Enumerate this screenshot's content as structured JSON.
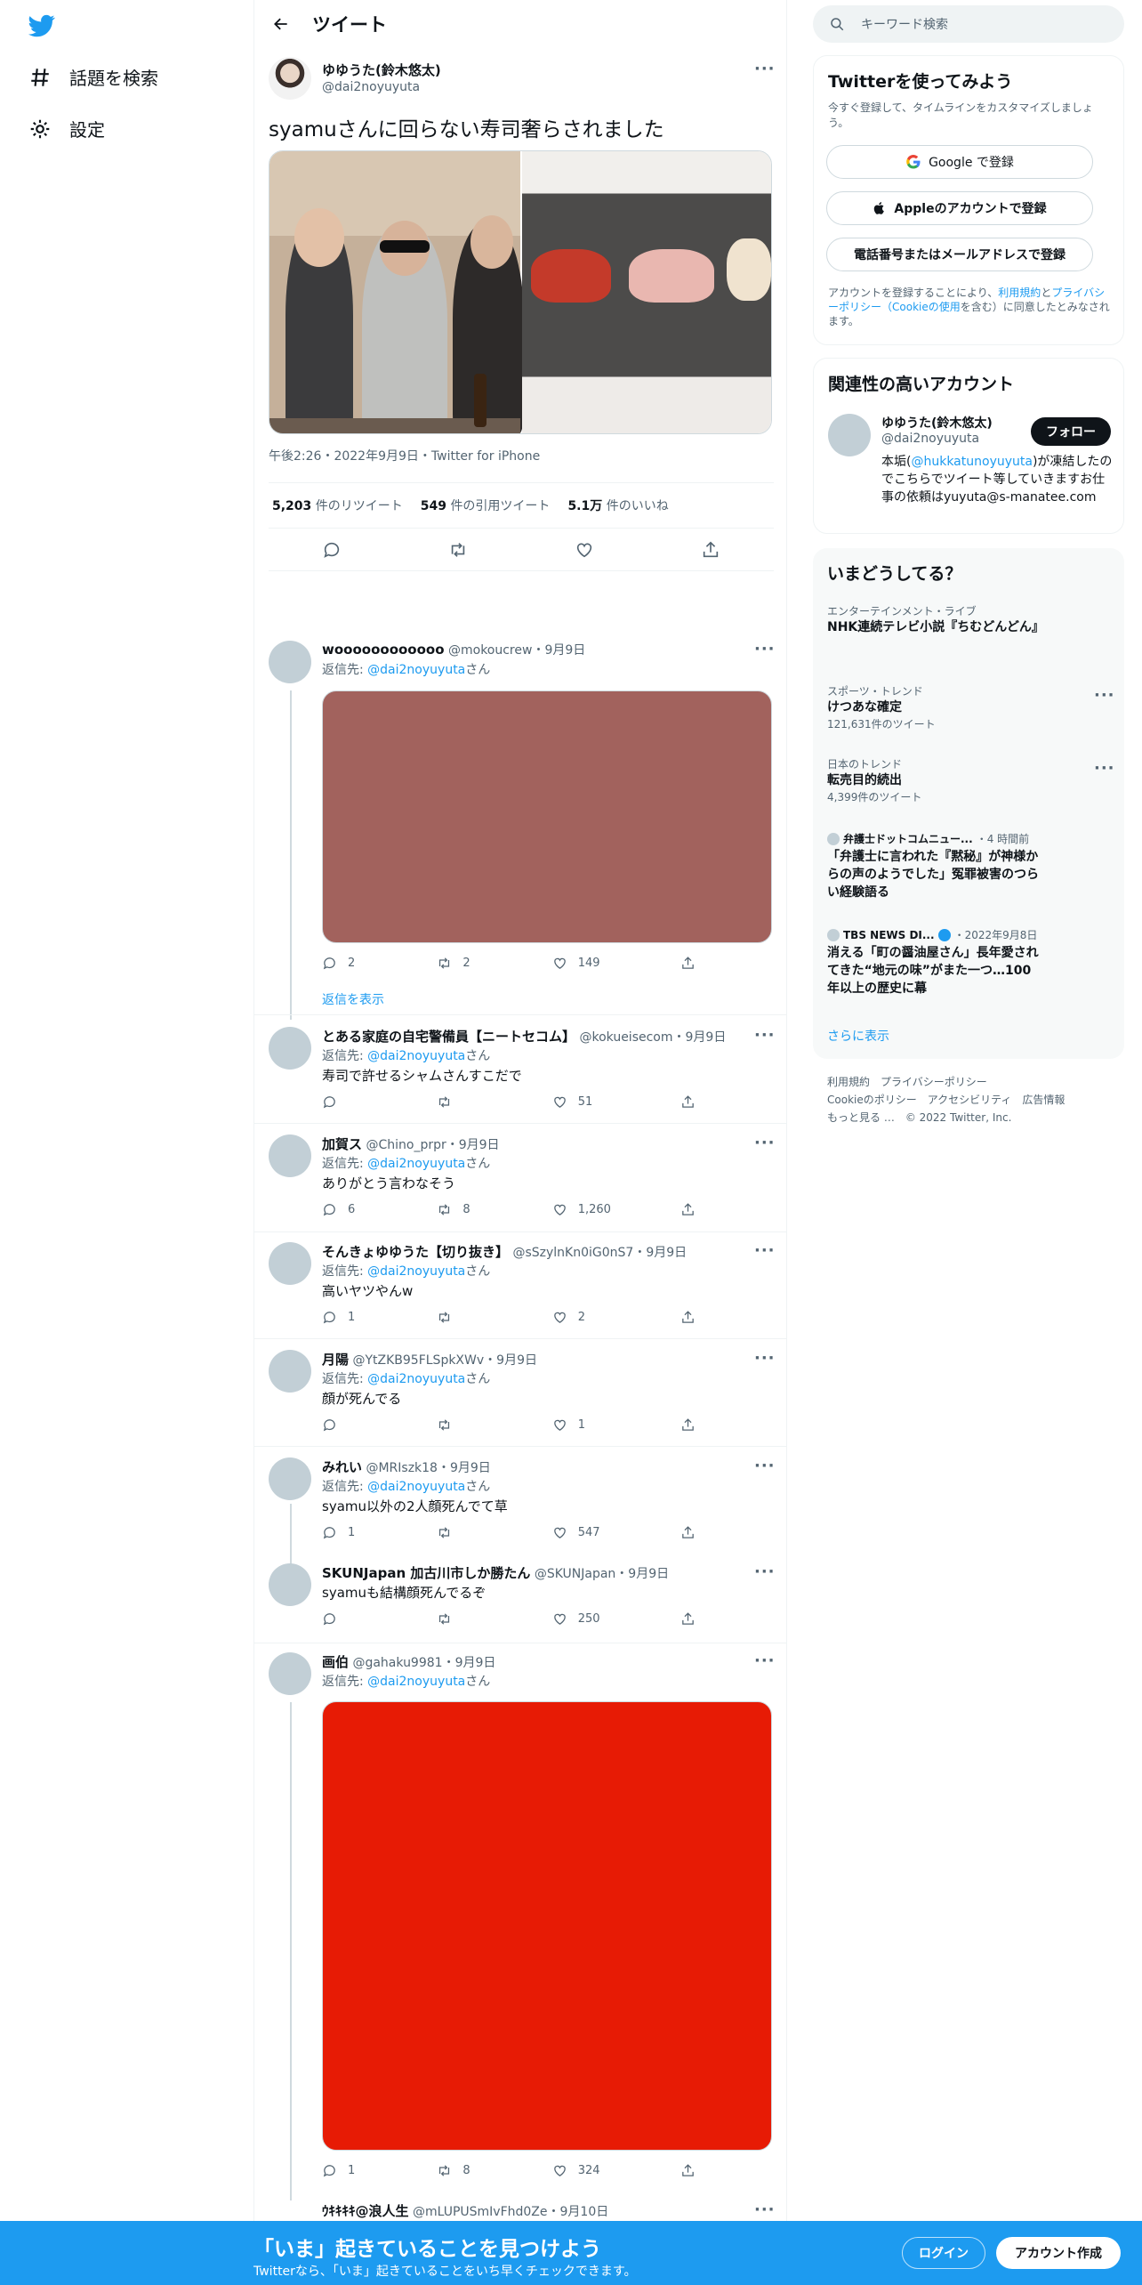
{
  "nav": {
    "explore": "話題を検索",
    "settings": "設定"
  },
  "header": {
    "title": "ツイート"
  },
  "tweet": {
    "name": "ゆゆうた(鈴木悠太)",
    "handle": "@dai2noyuyuta",
    "text": "syamuさんに回らない寿司奢らされました",
    "meta": "午後2:26・2022年9月9日・Twitter for iPhone",
    "retweets_num": "5,203",
    "retweets_label": "件のリツイート",
    "quotes_num": "549",
    "quotes_label": "件の引用ツイート",
    "likes_num": "5.1万",
    "likes_label": "件のいいね"
  },
  "replies": [
    {
      "name": "woooooooooooo",
      "handle": "@mokoucrew",
      "date": "・9月9日",
      "reply_to_label": "返信先:",
      "reply_to": "@dai2noyuyuta",
      "suffix": "さん",
      "text": "",
      "replies": "2",
      "retweets": "2",
      "likes": "149"
    },
    {
      "name": "とある家庭の自宅警備員【ニートセコム】",
      "handle": "@kokueisecom",
      "date": "・9月9日",
      "reply_to_label": "返信先:",
      "reply_to": "@dai2noyuyuta",
      "suffix": "さん",
      "text": "寿司で許せるシャムさんすこだで",
      "replies": "",
      "retweets": "",
      "likes": "51"
    },
    {
      "name": "加賀ス",
      "handle": "@Chino_prpr",
      "date": "・9月9日",
      "reply_to_label": "返信先:",
      "reply_to": "@dai2noyuyuta",
      "suffix": "さん",
      "text": "ありがとう言わなそう",
      "replies": "6",
      "retweets": "8",
      "likes": "1,260"
    },
    {
      "name": "そんきょゆゆうた【切り抜き】",
      "handle": "@sSzylnKn0iG0nS7",
      "date": "・9月9日",
      "reply_to_label": "返信先:",
      "reply_to": "@dai2noyuyuta",
      "suffix": "さん",
      "text": "高いヤツやんw",
      "replies": "1",
      "retweets": "",
      "likes": "2"
    },
    {
      "name": "月陽",
      "handle": "@YtZKB95FLSpkXWv",
      "date": "・9月9日",
      "reply_to_label": "返信先:",
      "reply_to": "@dai2noyuyuta",
      "suffix": "さん",
      "text": "顔が死んでる",
      "replies": "",
      "retweets": "",
      "likes": "1"
    },
    {
      "name": "みれい",
      "handle": "@MRIszk18",
      "date": "・9月9日",
      "reply_to_label": "返信先:",
      "reply_to": "@dai2noyuyuta",
      "suffix": "さん",
      "text": "syamu以外の2人顔死んでて草",
      "replies": "1",
      "retweets": "",
      "likes": "547"
    },
    {
      "name": "SKUNJapan 加古川市しか勝たん",
      "handle": "@SKUNJapan",
      "date": "・9月9日",
      "reply_to_label": "",
      "reply_to": "",
      "suffix": "",
      "text": "syamuも結構顔死んでるぞ",
      "replies": "",
      "retweets": "",
      "likes": "250"
    },
    {
      "name": "画伯",
      "handle": "@gahaku9981",
      "date": "・9月9日",
      "reply_to_label": "返信先:",
      "reply_to": "@dai2noyuyuta",
      "suffix": "さん",
      "text": "",
      "replies": "1",
      "retweets": "8",
      "likes": "324"
    },
    {
      "name": "ｳｷｷｷｷ@浪人生",
      "handle": "@mLUPUSmIvFhd0Ze",
      "date": "・9月10日"
    }
  ],
  "show_replies": "返信を表示",
  "right": {
    "search_placeholder": "キーワード検索",
    "signup_title": "Twitterを使ってみよう",
    "signup_sub": "今すぐ登録して、タイムラインをカスタマイズしましょう。",
    "google_btn": "Google で登録",
    "apple_btn": "Appleのアカウントで登録",
    "phone_btn": "電話番号またはメールアドレスで登録",
    "terms_1": "アカウントを登録することにより、",
    "terms_link1": "利用規約",
    "terms_2": "と",
    "terms_link2": "プライバシーポリシー（Cookieの使用",
    "terms_3": "を含む）に同意したとみなされます。",
    "related_title": "関連性の高いアカウント",
    "related_name": "ゆゆうた(鈴木悠太)",
    "related_handle": "@dai2noyuyuta",
    "follow_btn": "フォロー",
    "bio_1": "本垢(",
    "bio_link": "@hukkatunoyuyuta",
    "bio_2": ")が凍結したのでこちらでツイート等していきますお仕事の依頼はyuyuta@s-manatee.com",
    "trends_title": "いまどうしてる？",
    "trends": [
      {
        "cat": "エンターテインメント・ライブ",
        "title": "NHK連続テレビ小説『ちむどんどん』",
        "count": ""
      },
      {
        "cat": "スポーツ・トレンド",
        "title": "けつあな確定",
        "count": "121,631件のツイート"
      },
      {
        "cat": "日本のトレンド",
        "title": "転売目的続出",
        "count": "4,399件のツイート"
      }
    ],
    "news": [
      {
        "source": "弁護士ドットコムニュー...",
        "time": "・4 時間前",
        "title": "「弁護士に言われた『黙秘』が神様からの声のようでした」冤罪被害のつらい経験語る"
      },
      {
        "source": "TBS NEWS DI...",
        "time": "・2022年9月8日",
        "title": "消える「町の醤油屋さん」長年愛されてきた“地元の味”がまた一つ…100年以上の歴史に幕"
      }
    ],
    "show_more": "さらに表示",
    "footer_1": "利用規約　プライバシーポリシー",
    "footer_2": "Cookieのポリシー　アクセシビリティ　広告情報",
    "footer_3": "もっと見る …　© 2022 Twitter, Inc."
  },
  "bottom": {
    "title": "「いま」起きていることを見つけよう",
    "sub": "Twitterなら、「いま」起きていることをいち早くチェックできます。",
    "login": "ログイン",
    "signup": "アカウント作成"
  },
  "colors": {
    "accent": "#1d9bf0",
    "media1": "#a2625d",
    "media2": "#e71b05"
  }
}
